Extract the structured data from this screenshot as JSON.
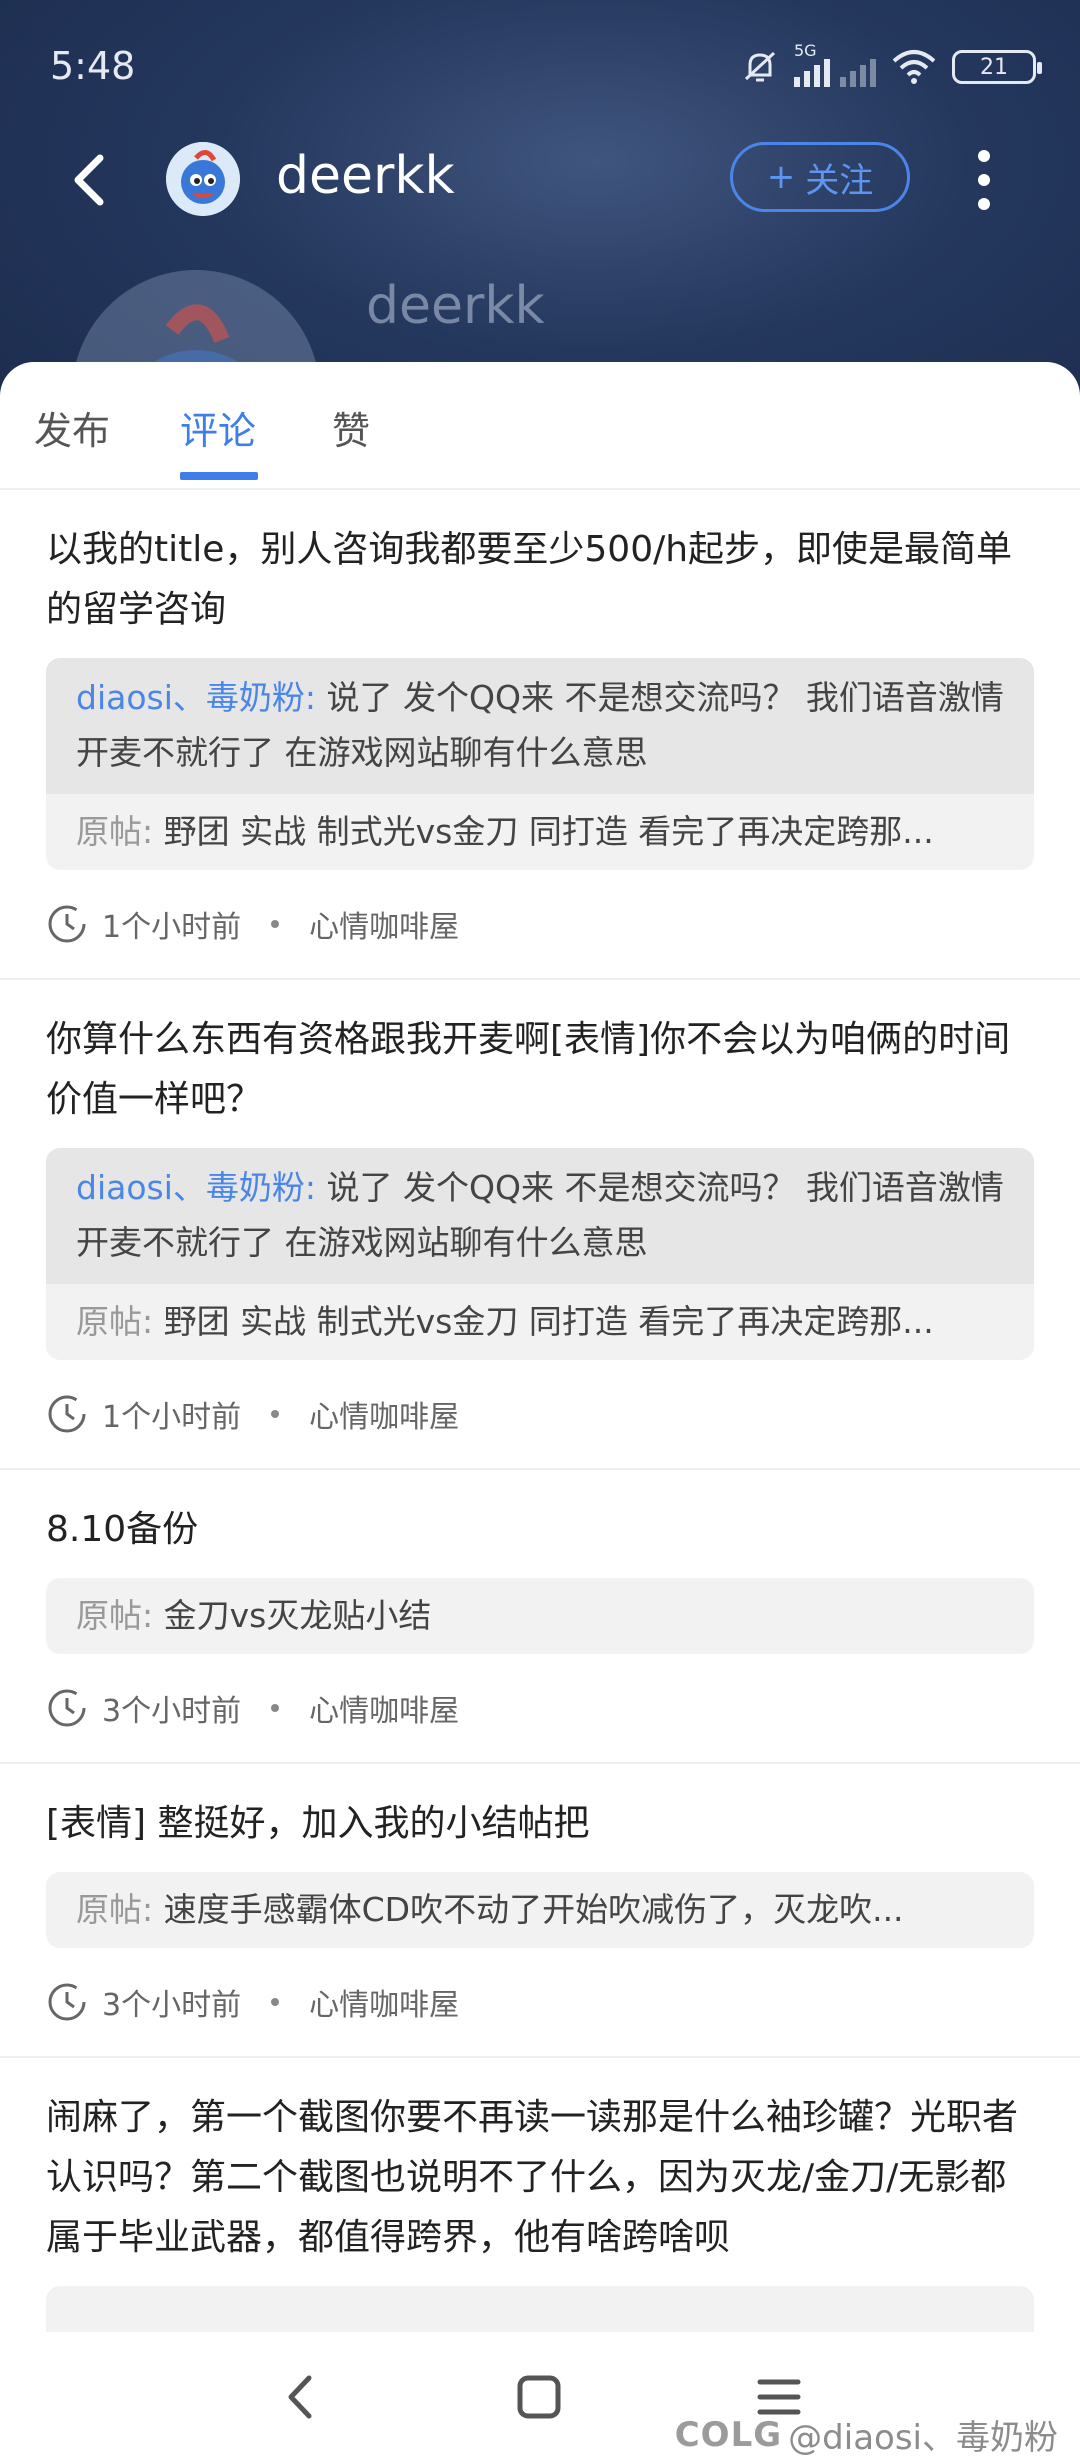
{
  "status_bar": {
    "time": "5:48",
    "network": "5G",
    "battery": "21"
  },
  "header": {
    "username": "deerkk",
    "follow_label": "关注",
    "ghost_name": "deerkk"
  },
  "tabs": [
    {
      "label": "发布",
      "active": false
    },
    {
      "label": "评论",
      "active": true
    },
    {
      "label": "赞",
      "active": false
    }
  ],
  "posts": [
    {
      "text": "以我的title，别人咨询我都要至少500/h起步，即使是最简单的留学咨询",
      "reply_user": "diaosi、毒奶粉:",
      "reply_text": "说了 发个QQ来 不是想交流吗？ 我们语音激情开麦不就行了 在游戏网站聊有什么意思",
      "orig_label": "原帖:",
      "orig_text": "野团 实战 制式光vs金刀 同打造 看完了再决定跨那...",
      "time": "1个小时前",
      "board": "心情咖啡屋"
    },
    {
      "text": "你算什么东西有资格跟我开麦啊[表情]你不会以为咱俩的时间价值一样吧？",
      "reply_user": "diaosi、毒奶粉:",
      "reply_text": "说了 发个QQ来 不是想交流吗？ 我们语音激情开麦不就行了 在游戏网站聊有什么意思",
      "orig_label": "原帖:",
      "orig_text": "野团 实战 制式光vs金刀 同打造 看完了再决定跨那...",
      "time": "1个小时前",
      "board": "心情咖啡屋"
    },
    {
      "text": "8.10备份",
      "orig_label": "原帖:",
      "orig_text": "金刀vs灭龙贴小结",
      "time": "3个小时前",
      "board": "心情咖啡屋"
    },
    {
      "text": "[表情] 整挺好，加入我的小结帖把",
      "orig_label": "原帖:",
      "orig_text": "速度手感霸体CD吹不动了开始吹减伤了，灭龙吹...",
      "time": "3个小时前",
      "board": "心情咖啡屋"
    },
    {
      "text": "闹麻了，第一个截图你要不再读一读那是什么袖珍罐？光职者认识吗？第二个截图也说明不了什么，因为灭龙/金刀/无影都属于毕业武器，都值得跨界，他有啥跨啥呗"
    }
  ],
  "watermark": {
    "logo": "COLG",
    "text": "@diaosi、毒奶粉"
  },
  "colors": {
    "accent": "#3f7ee8",
    "header_bg": "#24375d"
  }
}
